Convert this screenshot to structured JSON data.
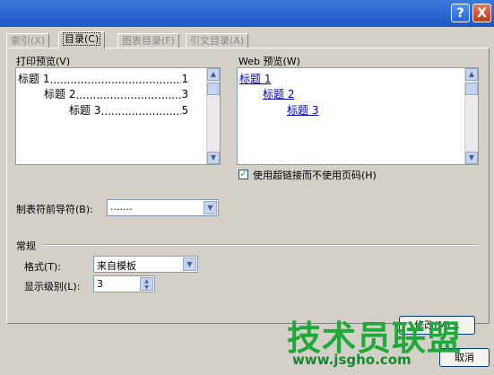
{
  "titlebar": {
    "help_label": "?",
    "close_label": "X"
  },
  "tabs": [
    {
      "label": "索引(X)"
    },
    {
      "label": "目录(C)"
    },
    {
      "label": "图表目录(F)"
    },
    {
      "label": "引文目录(A)"
    }
  ],
  "print_preview": {
    "label": "打印预览(V)",
    "entries": [
      {
        "text": "标题 1",
        "page": "1"
      },
      {
        "text": "标题 2",
        "page": "3"
      },
      {
        "text": "标题 3",
        "page": "5"
      }
    ]
  },
  "web_preview": {
    "label": "Web 预览(W)",
    "entries": [
      {
        "text": "标题 1"
      },
      {
        "text": "标题 2"
      },
      {
        "text": "标题 3"
      }
    ]
  },
  "hyperlink_checkbox": {
    "label": "使用超链接而不使用页码(H)",
    "checked": true,
    "mark": "✓"
  },
  "tab_leader": {
    "label": "制表符前导符(B):",
    "value": "......."
  },
  "general": {
    "section_label": "常规",
    "format_label": "格式(T):",
    "format_value": "来自模板",
    "levels_label": "显示级别(L):",
    "levels_value": "3"
  },
  "buttons": {
    "modify_label": "修改(M)...",
    "cancel_label": "取消"
  },
  "watermark": {
    "text": "技术员联盟",
    "url": "www.jsgho.com"
  },
  "colors": {
    "title_blue": "#1d55c7",
    "link_blue": "#0000cc",
    "watermark_green": "#1fa93a"
  }
}
